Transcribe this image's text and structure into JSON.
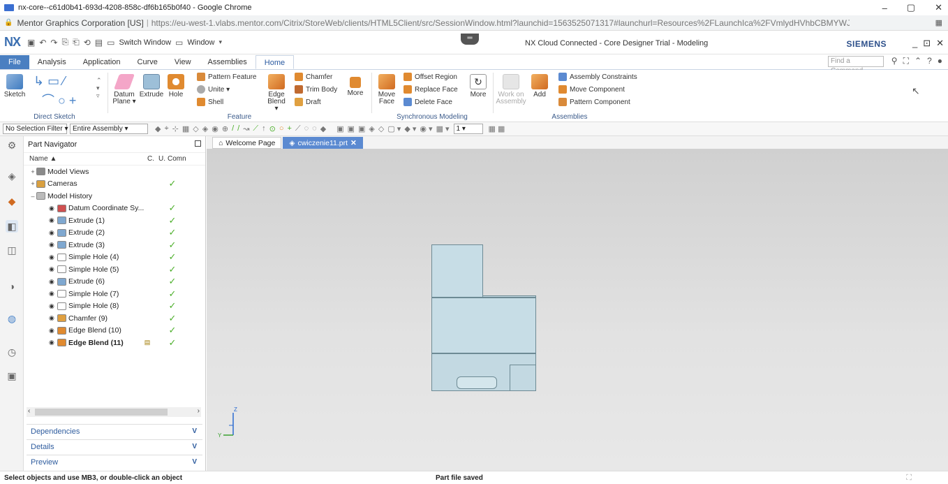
{
  "browser": {
    "window_title": "nx-core--c61d0b41-693d-4208-858c-df6b165b0f40 - Google Chrome",
    "site_identity": "Mentor Graphics Corporation [US]",
    "url": "https://eu-west-1.vlabs.mentor.com/Citrix/StoreWeb/clients/HTML5Client/src/SessionWindow.html?launchid=1563525071317#launchurl=Resources%2FLaunchIca%2FVmlydHVhbCBMYWJzLm54LWN...",
    "controls": [
      "–",
      "▢",
      "✕"
    ]
  },
  "nx": {
    "logo": "NX",
    "quick_access": [
      "Switch Window",
      "Window"
    ],
    "title": "NX Cloud Connected - Core Designer Trial - Modeling",
    "brand": "SIEMENS",
    "find_placeholder": "Find a Command",
    "window_controls": [
      "_",
      "⊡",
      "✕"
    ]
  },
  "tabs": [
    {
      "label": "File",
      "state": "file"
    },
    {
      "label": "Analysis",
      "state": ""
    },
    {
      "label": "Application",
      "state": ""
    },
    {
      "label": "Curve",
      "state": ""
    },
    {
      "label": "View",
      "state": ""
    },
    {
      "label": "Assemblies",
      "state": ""
    },
    {
      "label": "Home",
      "state": "active"
    }
  ],
  "ribbon": {
    "direct_sketch": {
      "label": "Direct Sketch",
      "sketch": "Sketch"
    },
    "feature": {
      "label": "Feature",
      "datum_plane": "Datum\nPlane ▾",
      "extrude": "Extrude",
      "hole": "Hole",
      "pattern_feature": "Pattern Feature",
      "unite": "Unite ▾",
      "shell": "Shell",
      "edge_blend": "Edge\nBlend ▾",
      "chamfer": "Chamfer",
      "trim_body": "Trim Body",
      "draft": "Draft",
      "more": "More"
    },
    "sync": {
      "label": "Synchronous Modeling",
      "move_face": "Move\nFace",
      "offset_region": "Offset Region",
      "replace_face": "Replace Face",
      "delete_face": "Delete Face",
      "more": "More"
    },
    "assemblies": {
      "label": "Assemblies",
      "work_on_assembly": "Work on\nAssembly",
      "add": "Add",
      "assembly_constraints": "Assembly Constraints",
      "move_component": "Move Component",
      "pattern_component": "Pattern Component"
    }
  },
  "selbar": {
    "filter": "No Selection Filter",
    "scope": "Entire Assembly",
    "layer": "1"
  },
  "navigator": {
    "title": "Part Navigator",
    "columns": {
      "name": "Name ▲",
      "c": "C.",
      "u": "U.",
      "comm": "Comn"
    },
    "rows": [
      {
        "name": "Model Views",
        "level": 0,
        "exp": "+",
        "eye": false,
        "icon": "#8a8a8a",
        "check": false,
        "c": "",
        "bold": false
      },
      {
        "name": "Cameras",
        "level": 0,
        "exp": "+",
        "eye": false,
        "icon": "#d9a040",
        "check": true,
        "c": "",
        "bold": false
      },
      {
        "name": "Model History",
        "level": 0,
        "exp": "–",
        "eye": false,
        "icon": "#bbbbbb",
        "check": false,
        "c": "",
        "bold": false
      },
      {
        "name": "Datum Coordinate Sy...",
        "level": 1,
        "exp": "",
        "eye": true,
        "icon": "#d05050",
        "check": true,
        "c": "",
        "bold": false
      },
      {
        "name": "Extrude (1)",
        "level": 1,
        "exp": "",
        "eye": true,
        "icon": "#7fa8d0",
        "check": true,
        "c": "",
        "bold": false
      },
      {
        "name": "Extrude (2)",
        "level": 1,
        "exp": "",
        "eye": true,
        "icon": "#7fa8d0",
        "check": true,
        "c": "",
        "bold": false
      },
      {
        "name": "Extrude (3)",
        "level": 1,
        "exp": "",
        "eye": true,
        "icon": "#7fa8d0",
        "check": true,
        "c": "",
        "bold": false
      },
      {
        "name": "Simple Hole (4)",
        "level": 1,
        "exp": "",
        "eye": true,
        "icon": "#ffffff",
        "check": true,
        "c": "",
        "bold": false
      },
      {
        "name": "Simple Hole (5)",
        "level": 1,
        "exp": "",
        "eye": true,
        "icon": "#ffffff",
        "check": true,
        "c": "",
        "bold": false
      },
      {
        "name": "Extrude (6)",
        "level": 1,
        "exp": "",
        "eye": true,
        "icon": "#7fa8d0",
        "check": true,
        "c": "",
        "bold": false
      },
      {
        "name": "Simple Hole (7)",
        "level": 1,
        "exp": "",
        "eye": true,
        "icon": "#ffffff",
        "check": true,
        "c": "",
        "bold": false
      },
      {
        "name": "Simple Hole (8)",
        "level": 1,
        "exp": "",
        "eye": true,
        "icon": "#ffffff",
        "check": true,
        "c": "",
        "bold": false
      },
      {
        "name": "Chamfer (9)",
        "level": 1,
        "exp": "",
        "eye": true,
        "icon": "#e0a040",
        "check": true,
        "c": "",
        "bold": false
      },
      {
        "name": "Edge Blend (10)",
        "level": 1,
        "exp": "",
        "eye": true,
        "icon": "#e08a30",
        "check": true,
        "c": "",
        "bold": false
      },
      {
        "name": "Edge Blend (11)",
        "level": 1,
        "exp": "",
        "eye": true,
        "icon": "#e08a30",
        "check": true,
        "c": "▤",
        "bold": true
      }
    ],
    "panels": [
      "Dependencies",
      "Details",
      "Preview"
    ]
  },
  "doc_tabs": [
    {
      "label": "Welcome Page",
      "active": false
    },
    {
      "label": "cwiczenie11.prt",
      "active": true
    }
  ],
  "triad": {
    "z": "Z",
    "y": "Y"
  },
  "status": {
    "left": "Select objects and use MB3, or double-click an object",
    "mid": "Part file saved"
  }
}
